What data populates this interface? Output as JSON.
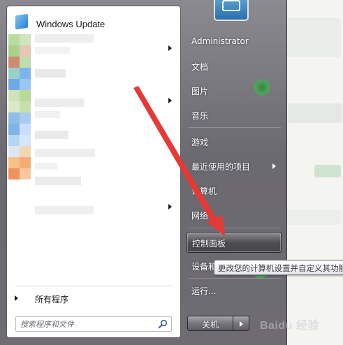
{
  "window": {
    "title": ""
  },
  "left_pane": {
    "pinned_item_label": "Windows Update",
    "all_programs_label": "所有程序",
    "search": {
      "placeholder": "搜索程序和文件",
      "value": ""
    }
  },
  "right_pane": {
    "items": [
      {
        "label": "Administrator",
        "has_submenu": false
      },
      {
        "label": "文档",
        "has_submenu": false
      },
      {
        "label": "图片",
        "has_submenu": false
      },
      {
        "label": "音乐",
        "has_submenu": false
      },
      {
        "label": "游戏",
        "has_submenu": false
      },
      {
        "label": "最近使用的项目",
        "has_submenu": true
      },
      {
        "label": "计算机",
        "has_submenu": false
      },
      {
        "label": "网络",
        "has_submenu": false
      },
      {
        "label": "控制面板",
        "has_submenu": false,
        "highlighted": true
      },
      {
        "label": "设备和",
        "has_submenu": false
      },
      {
        "label": "运行...",
        "has_submenu": false
      }
    ],
    "shutdown_label": "关机"
  },
  "tooltip": {
    "text": "更改您的计算机设置并自定义其功能"
  },
  "annotation": {
    "color": "#e53935"
  },
  "watermark": {
    "text": "Baidu 经验"
  },
  "colors": {
    "menu_glass": "#6e6b72",
    "highlight_border": "#2d2c30",
    "tooltip_border": "#767676"
  }
}
